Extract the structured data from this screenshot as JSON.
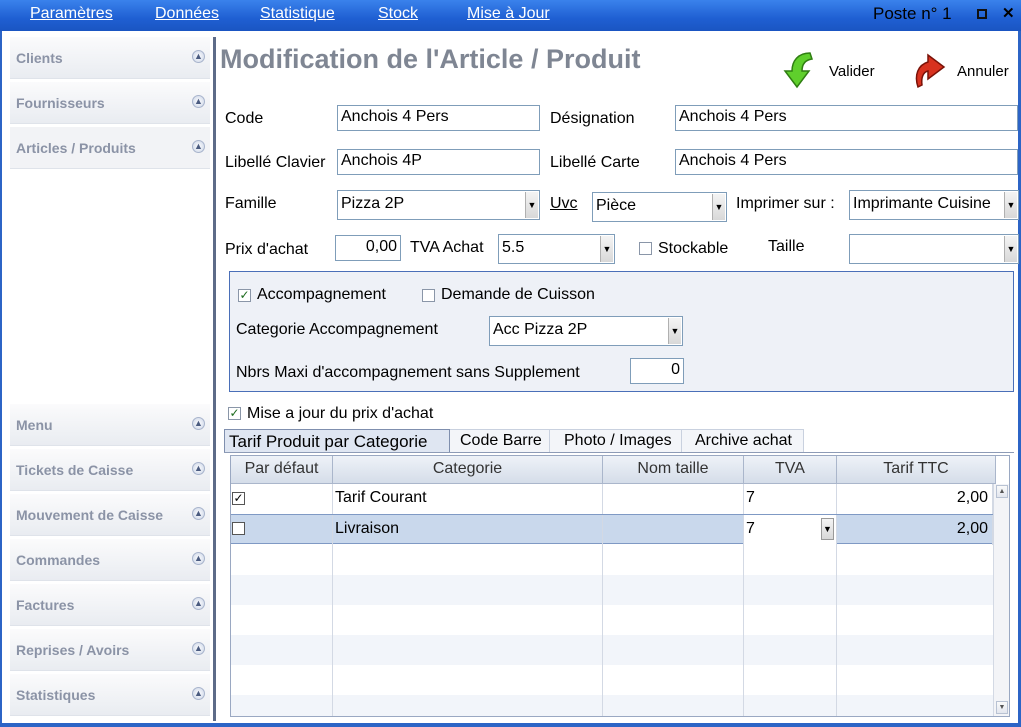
{
  "menu": [
    "Paramètres",
    "Données",
    "Statistique",
    "Stock",
    "Mise à Jour"
  ],
  "poste": "Poste n° 1",
  "window_buttons": {
    "close": "✕"
  },
  "sidebar": {
    "top_items": [
      "Clients",
      "Fournisseurs",
      "Articles / Produits"
    ],
    "bottom_items": [
      "Menu",
      "Tickets de Caisse",
      "Mouvement de Caisse",
      "Commandes",
      "Factures",
      "Reprises / Avoirs",
      "Statistiques"
    ]
  },
  "page": {
    "title": "Modification de l'Article / Produit",
    "valider": "Valider",
    "annuler": "Annuler"
  },
  "form": {
    "code_label": "Code",
    "code": "Anchois 4 Pers",
    "designation_label": "Désignation",
    "designation": "Anchois 4 Pers",
    "libelle_clavier_label": "Libellé Clavier",
    "libelle_clavier": "Anchois 4P",
    "libelle_carte_label": "Libellé Carte",
    "libelle_carte": "Anchois 4 Pers",
    "famille_label": "Famille",
    "famille": "Pizza 2P",
    "uvc_label": "Uvc",
    "uvc": "Pièce",
    "imprimer_label": "Imprimer sur :",
    "imprimer": "Imprimante Cuisine",
    "prix_achat_label": "Prix d'achat",
    "prix_achat": "0,00",
    "tva_achat_label": "TVA Achat",
    "tva_achat": "5.5",
    "stockable_label": "Stockable",
    "taille_label": "Taille",
    "taille": ""
  },
  "accomp": {
    "accompagnement_label": "Accompagnement",
    "demande_cuisson_label": "Demande de Cuisson",
    "categorie_label": "Categorie Accompagnement",
    "categorie": "Acc Pizza 2P",
    "nbrs_label": "Nbrs Maxi d'accompagnement sans Supplement",
    "nbrs": "0"
  },
  "maj_prix_label": "Mise a jour du prix d'achat",
  "tabs": [
    "Tarif Produit par Categorie",
    "Code Barre",
    "Photo / Images",
    "Archive achat"
  ],
  "grid": {
    "headers": [
      "Par défaut",
      "Categorie",
      "Nom taille",
      "TVA",
      "Tarif TTC"
    ],
    "rows": [
      {
        "default": true,
        "categorie": "Tarif Courant",
        "taille": "",
        "tva": "7",
        "tarif": "2,00"
      },
      {
        "default": false,
        "categorie": "Livraison",
        "taille": "",
        "tva": "7",
        "tarif": "2,00"
      }
    ]
  }
}
